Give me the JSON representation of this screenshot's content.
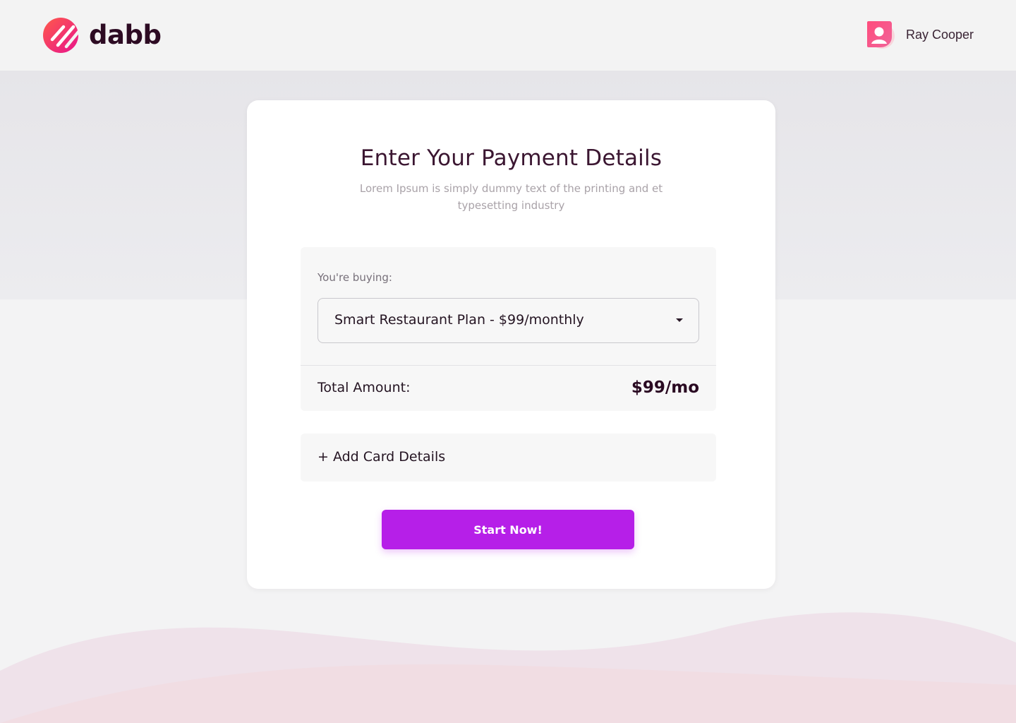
{
  "header": {
    "logo_text": "dabb",
    "user_name": "Ray Cooper"
  },
  "card": {
    "title": "Enter Your Payment Details",
    "subtitle": "Lorem Ipsum is simply dummy text of the printing and et typesetting industry",
    "buying_label": "You're buying:",
    "selected_plan": "Smart Restaurant Plan - $99/monthly",
    "total_label": "Total Amount:",
    "total_value": "$99/mo",
    "add_card_label": "+ Add Card Details",
    "start_button": "Start Now!"
  },
  "colors": {
    "accent": "#b61fe8",
    "brand_gradient": [
      "#ff4b55",
      "#e8148c"
    ],
    "text_dark": "#2d0b23"
  },
  "icons": [
    "logo-mark-icon",
    "user-avatar-icon",
    "caret-down-icon"
  ]
}
